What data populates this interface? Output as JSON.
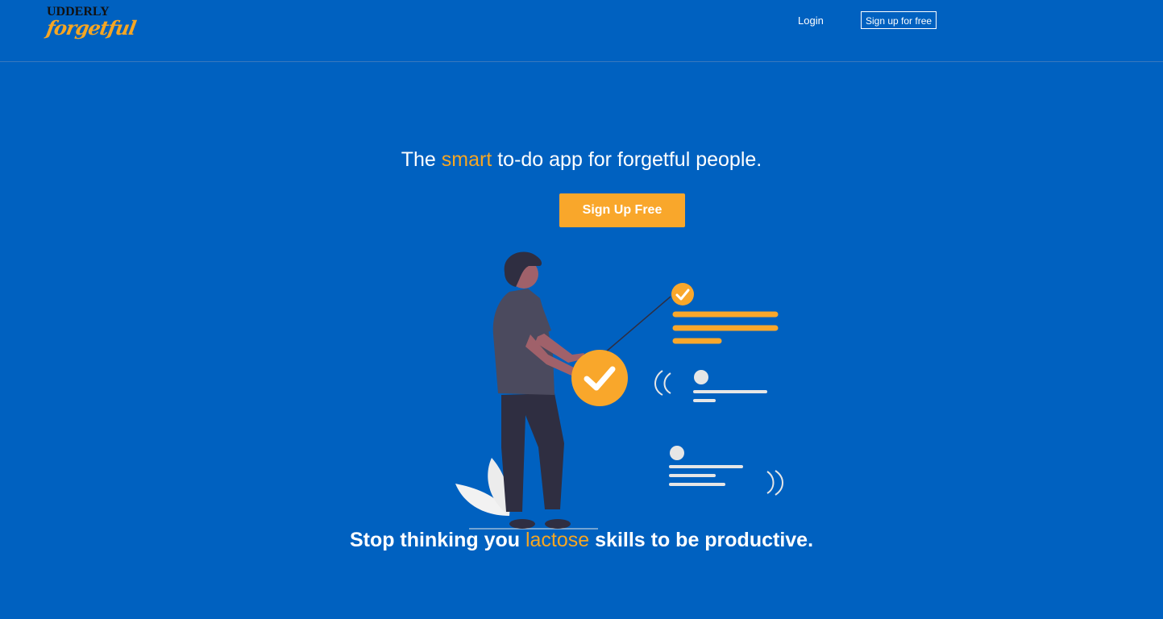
{
  "brand": {
    "logo_line1": "UDDERLY",
    "logo_line2": "forgetful"
  },
  "nav": {
    "login": "Login",
    "signup": "Sign up for free"
  },
  "hero": {
    "title_pre": "The ",
    "title_accent": "smart",
    "title_post": " to-do app for forgetful people.",
    "cta": "Sign Up Free"
  },
  "tagline": {
    "pre": "Stop thinking you ",
    "accent": "lactose",
    "post": " skills to be productive."
  },
  "colors": {
    "background": "#0061c0",
    "accent": "#f5a623",
    "cta": "#f9a72b"
  },
  "illustration": {
    "name": "person-checking-tasks",
    "icons": [
      "check-circle-icon",
      "big-check-circle-icon",
      "avatar-dot-icon",
      "signal-waves-icon"
    ]
  }
}
